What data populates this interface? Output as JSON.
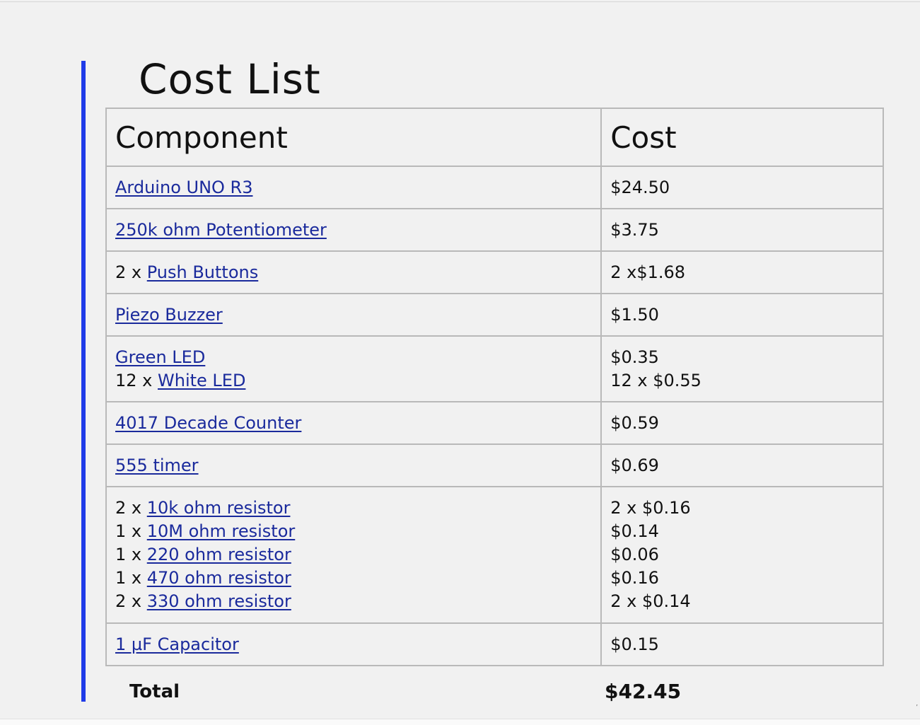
{
  "title": "Cost List",
  "table": {
    "headers": {
      "component": "Component",
      "cost": "Cost"
    },
    "rows": [
      {
        "component": [
          {
            "qty": "",
            "link": "Arduino UNO R3"
          }
        ],
        "cost": [
          "$24.50"
        ]
      },
      {
        "component": [
          {
            "qty": "",
            "link": "250k ohm Potentiometer"
          }
        ],
        "cost": [
          "$3.75"
        ]
      },
      {
        "component": [
          {
            "qty": "2 x ",
            "link": "Push Buttons"
          }
        ],
        "cost": [
          "2 x$1.68"
        ]
      },
      {
        "component": [
          {
            "qty": "",
            "link": "Piezo Buzzer"
          }
        ],
        "cost": [
          "$1.50"
        ]
      },
      {
        "component": [
          {
            "qty": "",
            "link": "Green LED"
          },
          {
            "qty": "12 x ",
            "link": "White LED"
          }
        ],
        "cost": [
          "$0.35",
          "12 x $0.55"
        ]
      },
      {
        "component": [
          {
            "qty": "",
            "link": "4017 Decade Counter"
          }
        ],
        "cost": [
          "$0.59"
        ]
      },
      {
        "component": [
          {
            "qty": "",
            "link": "555 timer"
          }
        ],
        "cost": [
          "$0.69"
        ]
      },
      {
        "component": [
          {
            "qty": "2 x ",
            "link": "10k ohm resistor"
          },
          {
            "qty": "1 x ",
            "link": "10M ohm resistor"
          },
          {
            "qty": "1 x ",
            "link": "220 ohm resistor"
          },
          {
            "qty": "1 x ",
            "link": "470 ohm resistor"
          },
          {
            "qty": "2 x ",
            "link": "330 ohm resistor"
          }
        ],
        "cost": [
          "2 x $0.16",
          "$0.14",
          "$0.06",
          "$0.16",
          "2 x $0.14"
        ]
      },
      {
        "component": [
          {
            "qty": "",
            "link": "1 µF Capacitor"
          }
        ],
        "cost": [
          "$0.15"
        ]
      }
    ]
  },
  "total": {
    "label": "Total",
    "value": "$42.45"
  },
  "colors": {
    "accent_bar": "#1f3be8",
    "link": "#1a2a9c",
    "grid": "#b9b9b9"
  }
}
